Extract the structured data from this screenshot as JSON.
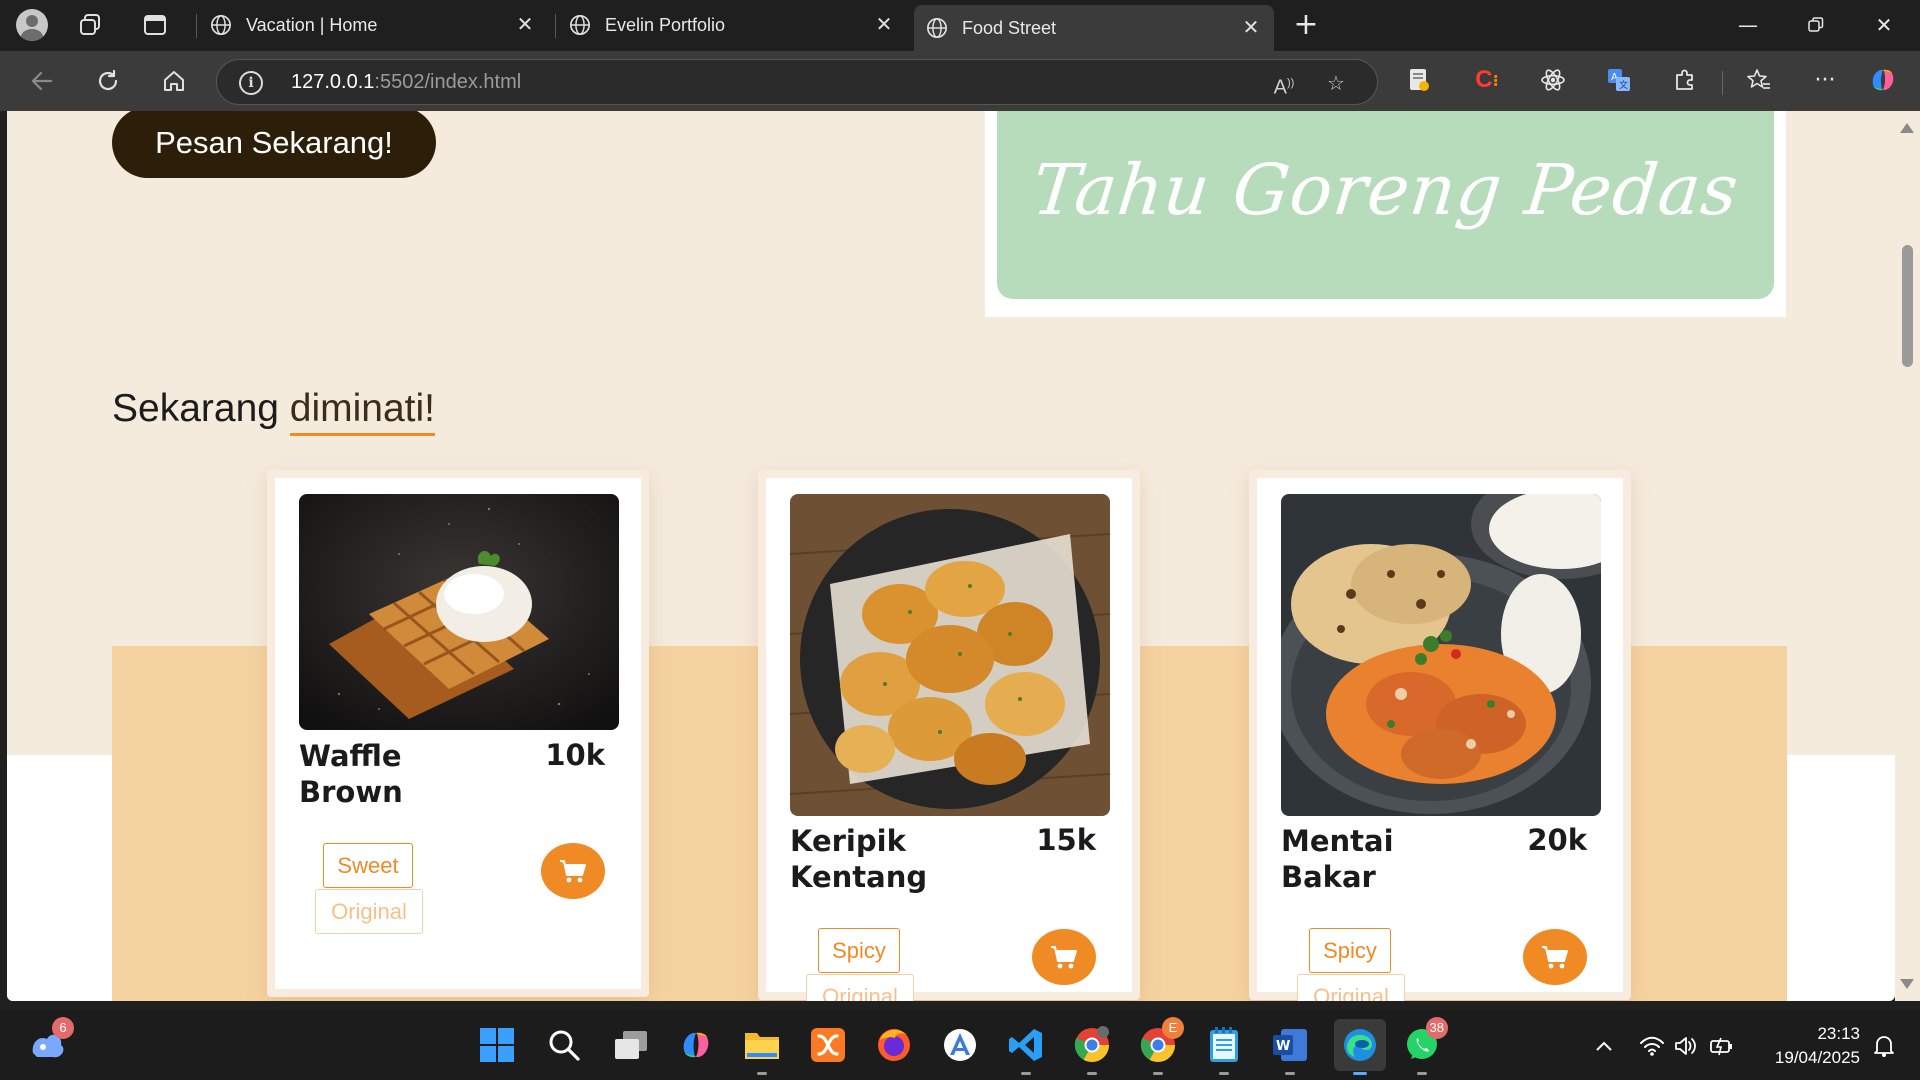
{
  "browser": {
    "tabs": [
      {
        "title": "Vacation | Home",
        "active": false
      },
      {
        "title": "Evelin Portfolio",
        "active": false
      },
      {
        "title": "Food Street",
        "active": true
      }
    ],
    "url_host": "127.0.0.1",
    "url_path": ":5502/index.html"
  },
  "page": {
    "cta_label": "Pesan Sekarang!",
    "banner_text": "Tahu Goreng Pedas",
    "section_title_plain": "Sekarang ",
    "section_title_highlight": "diminati!",
    "cards": [
      {
        "name_line1": "Waffle",
        "name_line2": "Brown",
        "price": "10k",
        "tags": [
          "Sweet",
          "Original"
        ]
      },
      {
        "name_line1": "Keripik",
        "name_line2": "Kentang",
        "price": "15k",
        "tags": [
          "Spicy",
          "Original"
        ]
      },
      {
        "name_line1": "Mentai",
        "name_line2": "Bakar",
        "price": "20k",
        "tags": [
          "Spicy",
          "Original"
        ]
      }
    ]
  },
  "taskbar": {
    "time": "23:13",
    "date": "19/04/2025",
    "widgets_badge": "6",
    "whatsapp_badge": "38",
    "chrome_badge": "E"
  },
  "colors": {
    "accent": "#f08a24",
    "page_bg": "#f5ebdd",
    "band": "#f5d3a1",
    "cta_bg": "#2d1e09",
    "banner_green": "#b6dcbc"
  }
}
